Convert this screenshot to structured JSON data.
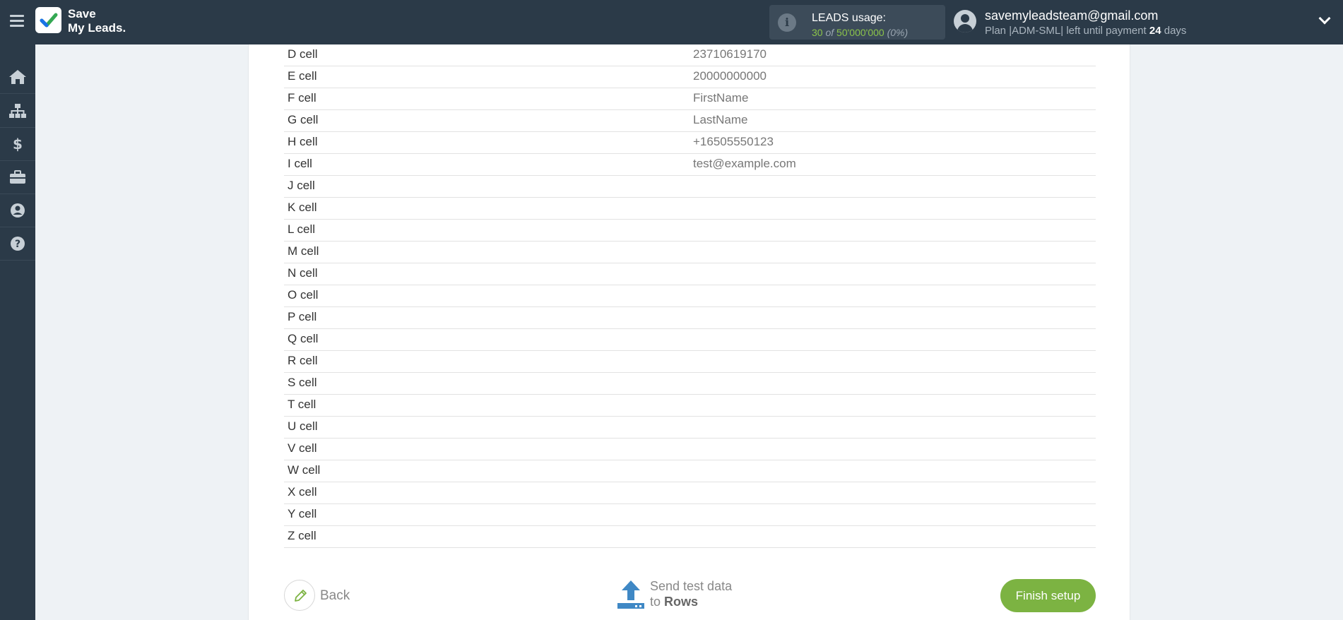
{
  "header": {
    "logo": {
      "line1": "Save",
      "line2": "My Leads."
    },
    "usage": {
      "label": "LEADS usage:",
      "count": "30",
      "of": "of",
      "limit": "50'000'000",
      "pct": "(0%)"
    },
    "account": {
      "email": "savemyleadsteam@gmail.com",
      "plan_prefix": "Plan |ADM-SML| left until payment",
      "days": "24",
      "days_suffix": "days"
    }
  },
  "sidebar": {
    "items": [
      "home-icon",
      "sitemap-icon",
      "dollar-icon",
      "briefcase-icon",
      "user-icon",
      "help-icon"
    ]
  },
  "rows": [
    {
      "label": "D cell",
      "value": "23710619170"
    },
    {
      "label": "E cell",
      "value": "20000000000"
    },
    {
      "label": "F cell",
      "value": "FirstName"
    },
    {
      "label": "G cell",
      "value": "LastName"
    },
    {
      "label": "H cell",
      "value": "+16505550123"
    },
    {
      "label": "I cell",
      "value": "test@example.com"
    },
    {
      "label": "J cell",
      "value": ""
    },
    {
      "label": "K cell",
      "value": ""
    },
    {
      "label": "L cell",
      "value": ""
    },
    {
      "label": "M cell",
      "value": ""
    },
    {
      "label": "N cell",
      "value": ""
    },
    {
      "label": "O cell",
      "value": ""
    },
    {
      "label": "P cell",
      "value": ""
    },
    {
      "label": "Q cell",
      "value": ""
    },
    {
      "label": "R cell",
      "value": ""
    },
    {
      "label": "S cell",
      "value": ""
    },
    {
      "label": "T cell",
      "value": ""
    },
    {
      "label": "U cell",
      "value": ""
    },
    {
      "label": "V cell",
      "value": ""
    },
    {
      "label": "W cell",
      "value": ""
    },
    {
      "label": "X cell",
      "value": ""
    },
    {
      "label": "Y cell",
      "value": ""
    },
    {
      "label": "Z cell",
      "value": ""
    }
  ],
  "footer": {
    "back_label": "Back",
    "send_line1": "Send test data",
    "send_to": "to",
    "send_target": "Rows",
    "finish_label": "Finish setup"
  },
  "colors": {
    "topbar": "#2b3a48",
    "accent_green": "#7cb342",
    "usage_green": "#8bc34a"
  }
}
